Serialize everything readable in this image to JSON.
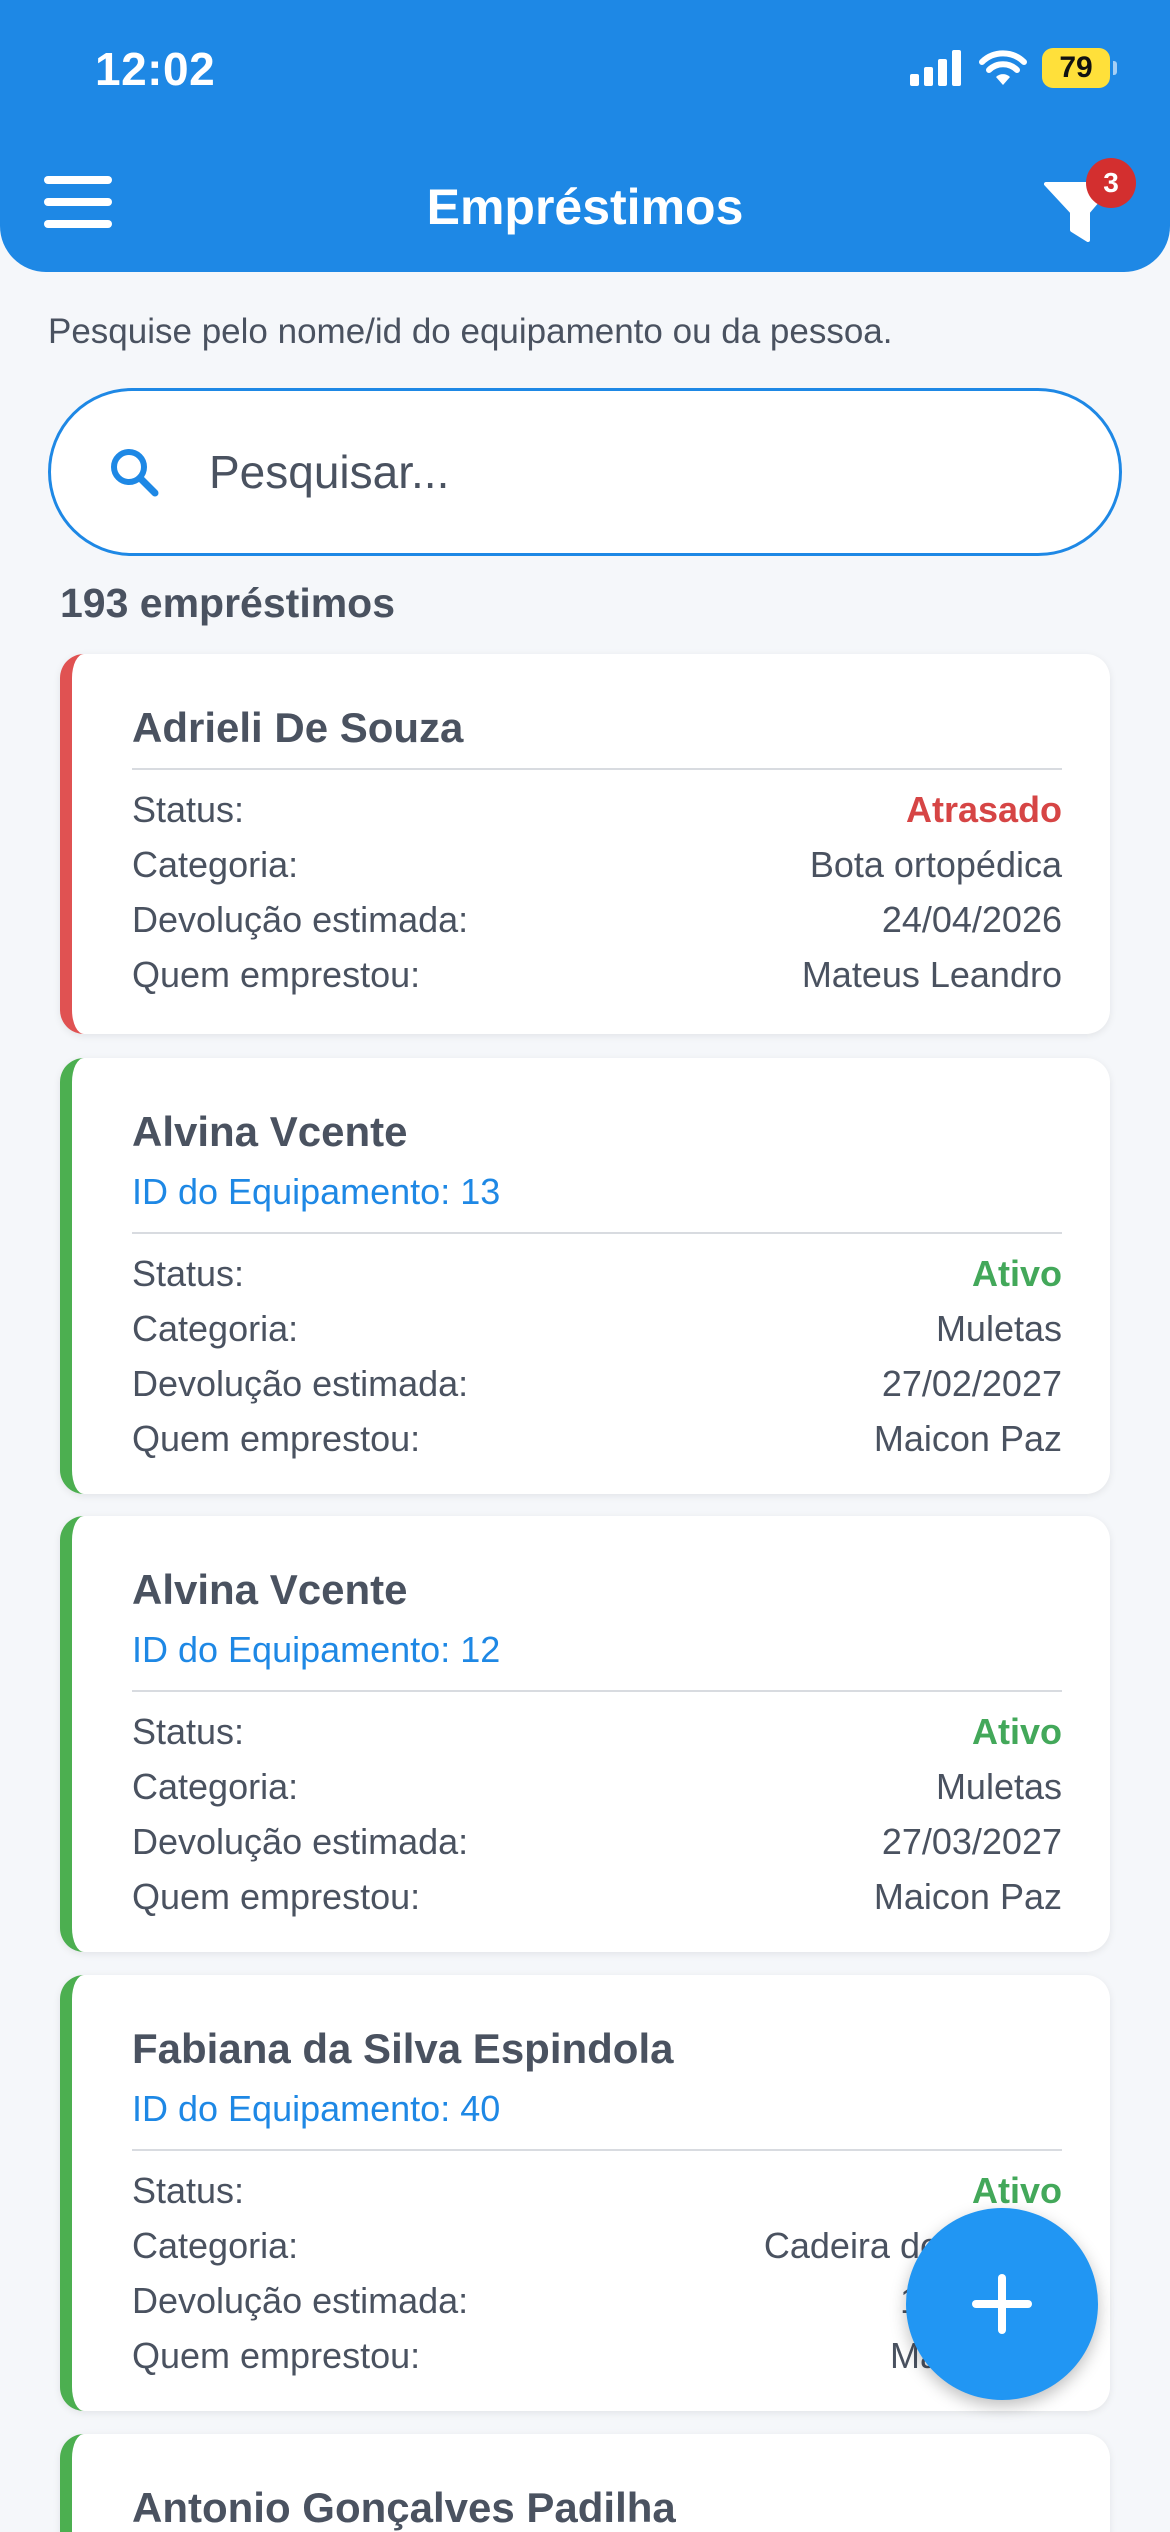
{
  "status_bar": {
    "time": "12:02",
    "battery": "79"
  },
  "header": {
    "title": "Empréstimos",
    "filter_badge": "3"
  },
  "search": {
    "hint": "Pesquise pelo nome/id do equipamento ou da pessoa.",
    "placeholder": "Pesquisar..."
  },
  "summary": {
    "count_text": "193 empréstimos"
  },
  "labels": {
    "status": "Status:",
    "category": "Categoria:",
    "return_date": "Devolução estimada:",
    "lender": "Quem emprestou:"
  },
  "colors": {
    "primary": "#1e88e5",
    "ok": "#43a85a",
    "late": "#d64545",
    "fab": "#2196f3"
  },
  "loans": [
    {
      "name": "Adrieli De Souza",
      "equipment_id": "",
      "status": "Atrasado",
      "category": "Bota ortopédica",
      "return_date": "24/04/2026",
      "lender": "Mateus Leandro"
    },
    {
      "name": "Alvina Vcente",
      "equipment_id": "ID do Equipamento: 13",
      "status": "Ativo",
      "category": "Muletas",
      "return_date": "27/02/2027",
      "lender": "Maicon Paz"
    },
    {
      "name": "Alvina Vcente",
      "equipment_id": "ID do Equipamento: 12",
      "status": "Ativo",
      "category": "Muletas",
      "return_date": "27/03/2027",
      "lender": "Maicon Paz"
    },
    {
      "name": "Fabiana da Silva Espindola",
      "equipment_id": "ID do Equipamento: 40",
      "status": "Ativo",
      "category": "Cadeira de",
      "return_date": "10",
      "lender": "Ma"
    },
    {
      "name": "Antonio Gonçalves Padilha"
    }
  ]
}
